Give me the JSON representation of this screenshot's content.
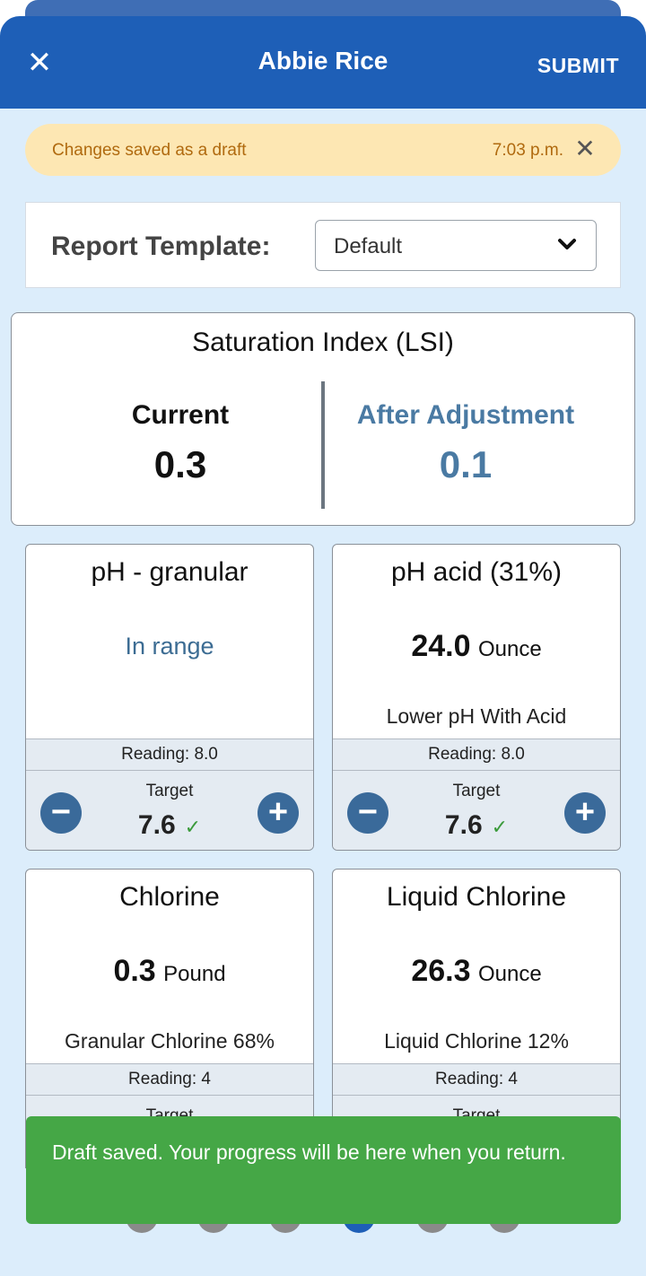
{
  "header": {
    "title": "Abbie Rice",
    "submit_label": "SUBMIT",
    "close_icon": "close-icon"
  },
  "banner": {
    "message": "Changes saved as a draft",
    "time": "7:03 p.m.",
    "dismiss_icon": "close-icon",
    "bg_color": "#fde7b3"
  },
  "report_template": {
    "label": "Report Template:",
    "selected": "Default"
  },
  "lsi": {
    "title": "Saturation Index (LSI)",
    "current_label": "Current",
    "current_value": "0.3",
    "after_label": "After Adjustment",
    "after_value": "0.1",
    "after_color": "#4a7aa3"
  },
  "cards": [
    {
      "title": "pH - granular",
      "status": "In range",
      "reading": "Reading: 8.0",
      "target_label": "Target",
      "target_value": "7.6"
    },
    {
      "title": "pH acid (31%)",
      "amount": "24.0",
      "unit": "Ounce",
      "product": "Lower pH With Acid",
      "reading": "Reading: 8.0",
      "target_label": "Target",
      "target_value": "7.6"
    },
    {
      "title": "Chlorine",
      "amount": "0.3",
      "unit": "Pound",
      "product": "Granular Chlorine 68%",
      "reading": "Reading: 4",
      "target_label": "Target"
    },
    {
      "title": "Liquid Chlorine",
      "amount": "26.3",
      "unit": "Ounce",
      "product": "Liquid Chlorine 12%",
      "reading": "Reading: 4",
      "target_label": "Target"
    }
  ],
  "toast": {
    "message": "Draft saved. Your progress will be here when you return.",
    "bg_color": "#45a746"
  },
  "colors": {
    "header": "#1e5fb7",
    "background": "#dcedfb",
    "accent_button": "#3a6a9a"
  }
}
